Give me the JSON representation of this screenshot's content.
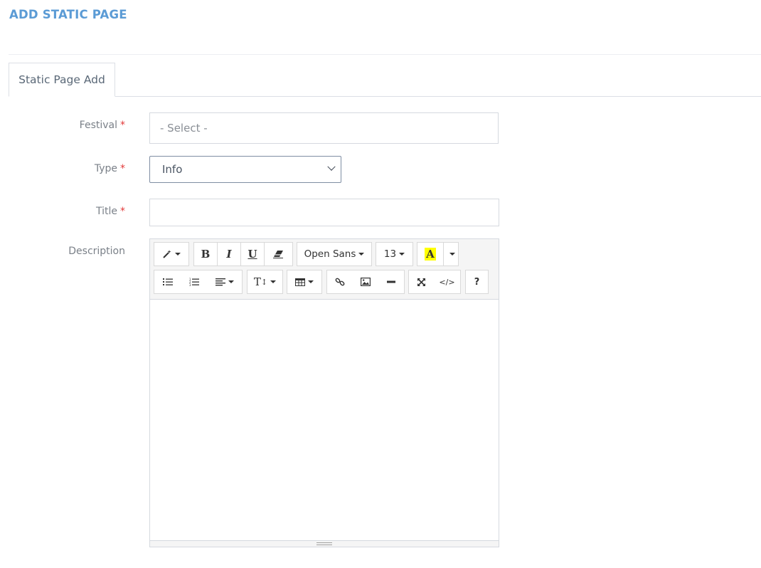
{
  "page": {
    "title": "ADD STATIC PAGE"
  },
  "tabs": [
    {
      "label": "Static Page Add",
      "active": true
    }
  ],
  "form": {
    "festival": {
      "label": "Festival",
      "required_mark": "*",
      "value": "- Select -"
    },
    "type": {
      "label": "Type",
      "required_mark": "*",
      "value": "Info"
    },
    "title": {
      "label": "Title",
      "required_mark": "*",
      "value": ""
    },
    "description": {
      "label": "Description"
    }
  },
  "editor": {
    "toolbar": {
      "style_icon": "magic-wand-icon",
      "bold": "B",
      "italic": "I",
      "underline": "U",
      "eraser_icon": "eraser-icon",
      "font_name": "Open Sans",
      "font_size": "13",
      "color_letter": "A",
      "highlight_color": "#ffff00",
      "ul_icon": "unordered-list-icon",
      "ol_icon": "ordered-list-icon",
      "align_icon": "align-left-icon",
      "line_height": "T",
      "table_icon": "table-icon",
      "link_icon": "link-icon",
      "picture_icon": "picture-icon",
      "hr_icon": "horizontal-rule-icon",
      "fullscreen_icon": "fullscreen-icon",
      "codeview": "</>",
      "help": "?"
    },
    "content": ""
  },
  "colors": {
    "title": "#5b9bd5",
    "required": "#e23a3a",
    "toolbar_bg": "#f5f5f5"
  }
}
